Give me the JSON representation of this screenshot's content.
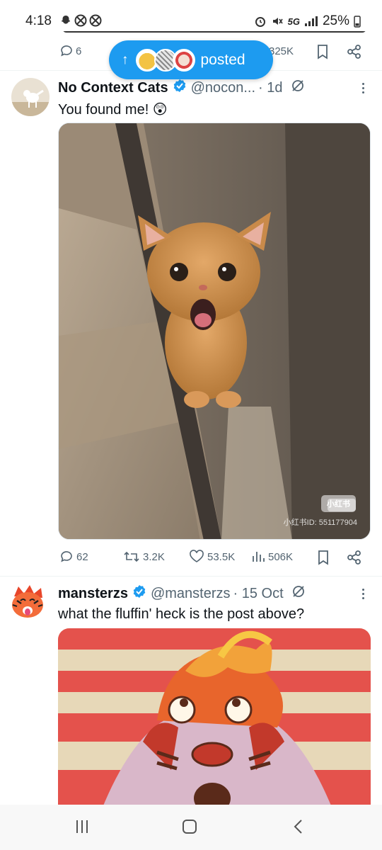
{
  "status_bar": {
    "time": "4:18",
    "network": "5G",
    "battery": "25%"
  },
  "prev_tweet": {
    "reply_count": "6",
    "views_count": "325K"
  },
  "posted_pill": {
    "label": "posted",
    "arrow_icon": "arrow-up-icon"
  },
  "tweet1": {
    "name": "No Context Cats",
    "handle": "@nocon...",
    "time": "· 1d",
    "text": "You found me! 😲",
    "media_watermark_logo": "小红书",
    "media_watermark_id": "小红书ID: 551177904",
    "replies": "62",
    "reposts": "3.2K",
    "likes": "53.5K",
    "views": "506K"
  },
  "tweet2": {
    "name": "mansterzs",
    "handle": "@mansterzs",
    "time": "· 15 Oct",
    "text": "what the fluffin' heck is the post above?"
  },
  "colors": {
    "accent": "#1d9bf0",
    "secondary_text": "#536471",
    "primary_text": "#0f1419"
  }
}
